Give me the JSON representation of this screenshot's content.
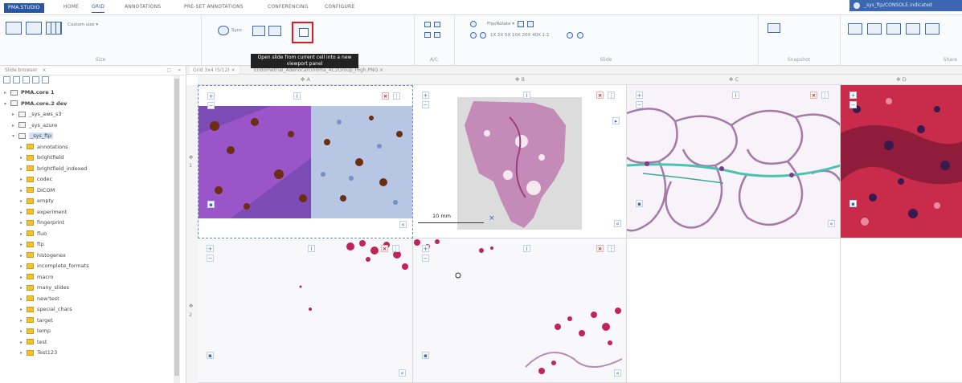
{
  "app": {
    "brand": "PMA.STUDIO",
    "user": "_sys_ftp/CONSOLE.indicated"
  },
  "menu": {
    "tabs": [
      "HOME",
      "GRID",
      "ANNOTATIONS",
      "PRE-SET ANNOTATIONS",
      "CONFERENCING",
      "CONFIGURE"
    ],
    "active": "GRID"
  },
  "ribbon": {
    "custom_size": "Custom size ▾",
    "size_label": "Size",
    "sync_label": "Sync",
    "ac_label": "A/C",
    "flip_rotate": "Flip/Rotate ▾",
    "zoom_levels": "1X 2X 5X 10X 20X 40X 1:1",
    "slide_label": "Slide",
    "snapshot_label": "Snapshot",
    "share_label": "Share",
    "tooltip": "Open slide from current cell into a new viewport panel"
  },
  "left_panel": {
    "title": "Slide browser",
    "tree": [
      {
        "label": "PMA.core 1",
        "kind": "server",
        "depth": 0,
        "bold": true,
        "arrow": "▸"
      },
      {
        "label": "PMA.core.2 dev",
        "kind": "server",
        "depth": 0,
        "bold": true,
        "arrow": "▾"
      },
      {
        "label": "_sys_aws_s3",
        "kind": "drive",
        "depth": 1,
        "arrow": "▸"
      },
      {
        "label": "_sys_azure",
        "kind": "drive",
        "depth": 1,
        "arrow": "▸"
      },
      {
        "label": "_sys_ftp",
        "kind": "drive",
        "depth": 1,
        "arrow": "▾",
        "selected": true
      },
      {
        "label": "annotations",
        "kind": "folder",
        "depth": 2,
        "arrow": "▸"
      },
      {
        "label": "brightfield",
        "kind": "folder",
        "depth": 2,
        "arrow": "▸"
      },
      {
        "label": "brightfield_indexed",
        "kind": "folder",
        "depth": 2,
        "arrow": "▸"
      },
      {
        "label": "codec",
        "kind": "folder",
        "depth": 2,
        "arrow": "▸"
      },
      {
        "label": "DICOM",
        "kind": "folder",
        "depth": 2,
        "arrow": "▸"
      },
      {
        "label": "empty",
        "kind": "folder",
        "depth": 2,
        "arrow": "▸"
      },
      {
        "label": "experiment",
        "kind": "folder",
        "depth": 2,
        "arrow": "▸"
      },
      {
        "label": "fingerprint",
        "kind": "folder",
        "depth": 2,
        "arrow": "▸"
      },
      {
        "label": "fluo",
        "kind": "folder",
        "depth": 2,
        "arrow": "▸"
      },
      {
        "label": "ftp",
        "kind": "folder",
        "depth": 2,
        "arrow": "▸"
      },
      {
        "label": "histogenex",
        "kind": "folder",
        "depth": 2,
        "arrow": "▸"
      },
      {
        "label": "incomplete_formats",
        "kind": "folder",
        "depth": 2,
        "arrow": "▸"
      },
      {
        "label": "macro",
        "kind": "folder",
        "depth": 2,
        "arrow": "▸"
      },
      {
        "label": "many_slides",
        "kind": "folder",
        "depth": 2,
        "arrow": "▸"
      },
      {
        "label": "new'test",
        "kind": "folder",
        "depth": 2,
        "arrow": "▸"
      },
      {
        "label": "special_chars",
        "kind": "folder",
        "depth": 2,
        "arrow": "▸"
      },
      {
        "label": "target",
        "kind": "folder",
        "depth": 2,
        "arrow": "▸"
      },
      {
        "label": "temp",
        "kind": "folder",
        "depth": 2,
        "arrow": "▸"
      },
      {
        "label": "test",
        "kind": "folder",
        "depth": 2,
        "arrow": "▸"
      },
      {
        "label": "Test123",
        "kind": "folder",
        "depth": 2,
        "arrow": "▸"
      }
    ]
  },
  "viewer": {
    "tabs": [
      "Grid 3x4 (5/12)",
      "Endometrial_Adenocarcinoma_4C2Group_High.PNG"
    ],
    "columns": [
      "A",
      "B",
      "C",
      "D"
    ],
    "rows": [
      "1",
      "2"
    ],
    "scalebar": "10 mm"
  },
  "colors": {
    "accent": "#2b57a0",
    "highlight": "#e01b1b",
    "tooltip_bg": "#222222"
  }
}
